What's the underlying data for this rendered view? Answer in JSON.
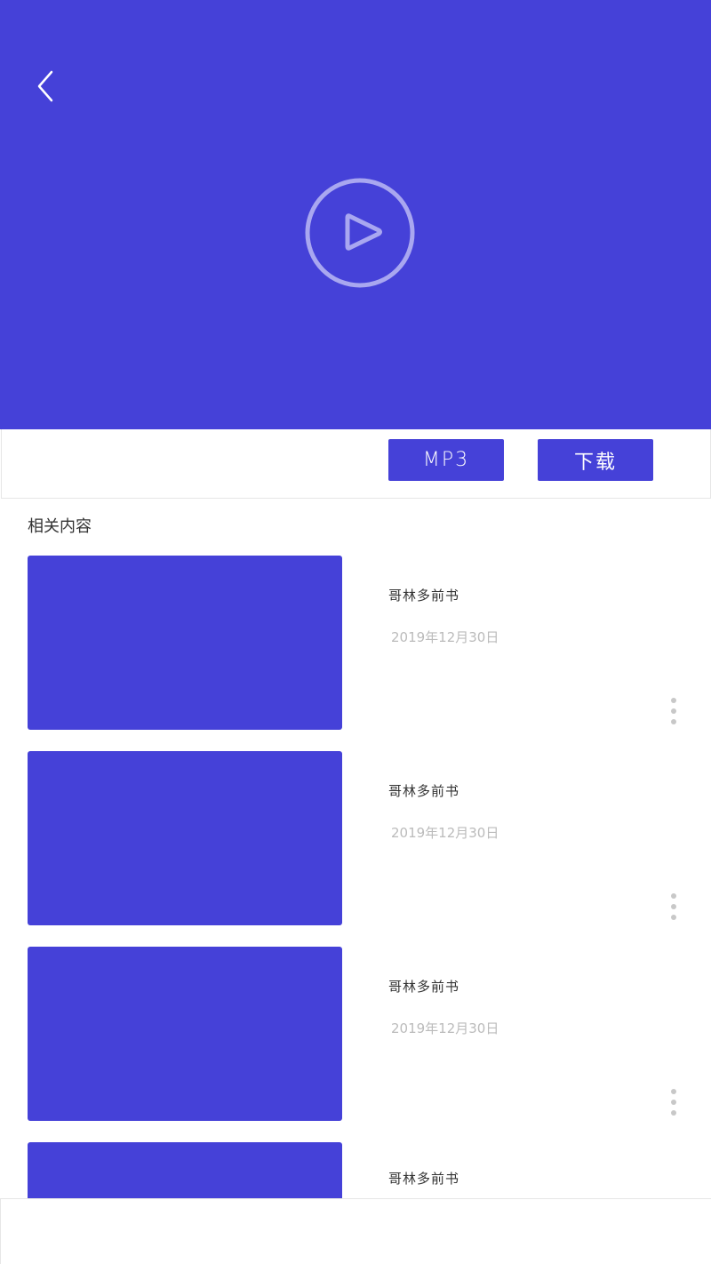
{
  "header": {
    "back_icon": "chevron-left-icon",
    "play_icon": "play-circle-icon",
    "background": "#4541d8"
  },
  "actions": {
    "mp3_label": "MP3",
    "download_label": "下载"
  },
  "related": {
    "title": "相关内容",
    "items": [
      {
        "title": "哥林多前书",
        "date": "2019年12月30日"
      },
      {
        "title": "哥林多前书",
        "date": "2019年12月30日"
      },
      {
        "title": "哥林多前书",
        "date": "2019年12月30日"
      },
      {
        "title": "哥林多前书",
        "date": ""
      }
    ]
  },
  "colors": {
    "accent": "#4541d8",
    "date_text": "#bbbbbb",
    "more_dots": "#c8c8c8"
  }
}
